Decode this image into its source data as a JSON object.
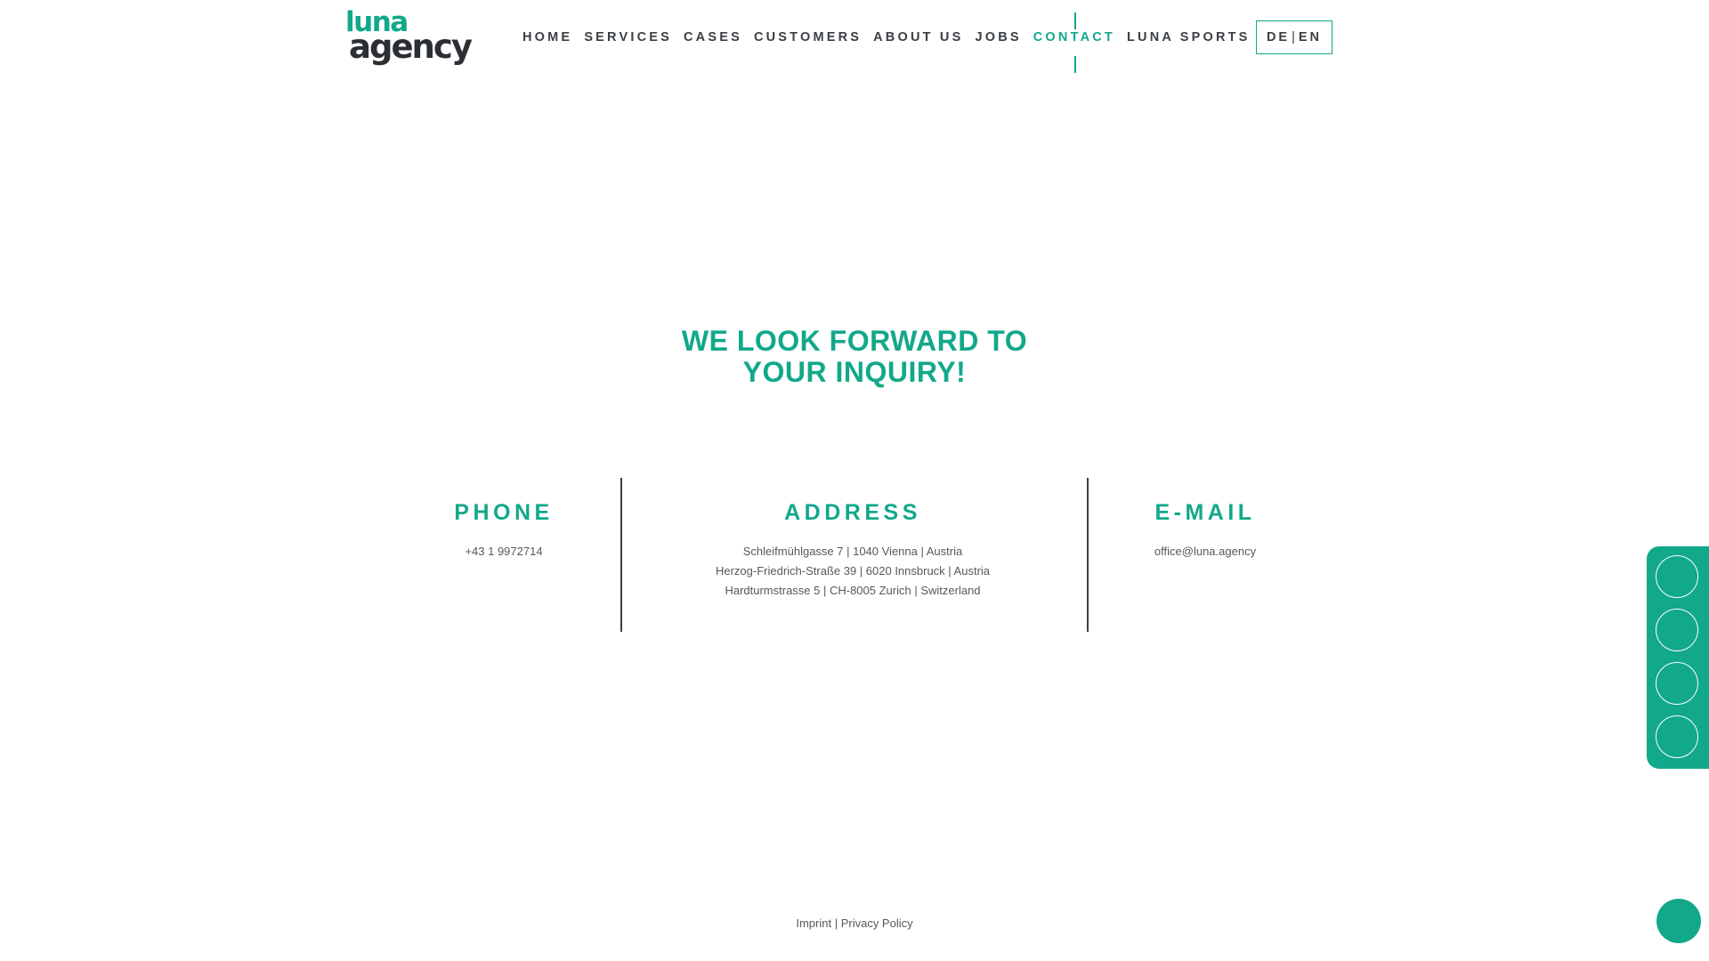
{
  "logo": {
    "line1": "luna",
    "line2": "agency"
  },
  "nav": {
    "items": [
      {
        "label": "HOME"
      },
      {
        "label": "SERVICES"
      },
      {
        "label": "CASES"
      },
      {
        "label": "CUSTOMERS"
      },
      {
        "label": "ABOUT US"
      },
      {
        "label": "JOBS"
      },
      {
        "label": "CONTACT",
        "active": true
      },
      {
        "label": "LUNA SPORTS"
      }
    ]
  },
  "language": {
    "de": "DE",
    "separator": "|",
    "en": "EN"
  },
  "heading": {
    "line1": "WE LOOK FORWARD TO",
    "line2": "YOUR INQUIRY!"
  },
  "contact": {
    "phone": {
      "title": "PHONE",
      "value": "+43 1 9972714"
    },
    "address": {
      "title": "ADDRESS",
      "lines": [
        "Schleifmühlgasse 7 | 1040 Vienna | Austria",
        "Herzog-Friedrich-Straße 39 | 6020 Innsbruck | Austria",
        "Hardturmstrasse 5 | CH-8005 Zurich | Switzerland"
      ]
    },
    "email": {
      "title": "E-MAIL",
      "value": "office@luna.agency"
    }
  },
  "footer": {
    "imprint": "Imprint",
    "separator": " | ",
    "privacy": "Privacy Policy"
  },
  "social": {
    "buttons": [
      "social-icon-1",
      "social-icon-2",
      "social-icon-3",
      "social-icon-4"
    ]
  },
  "colors": {
    "accent": "#12a88a",
    "text": "#3a3f44"
  }
}
